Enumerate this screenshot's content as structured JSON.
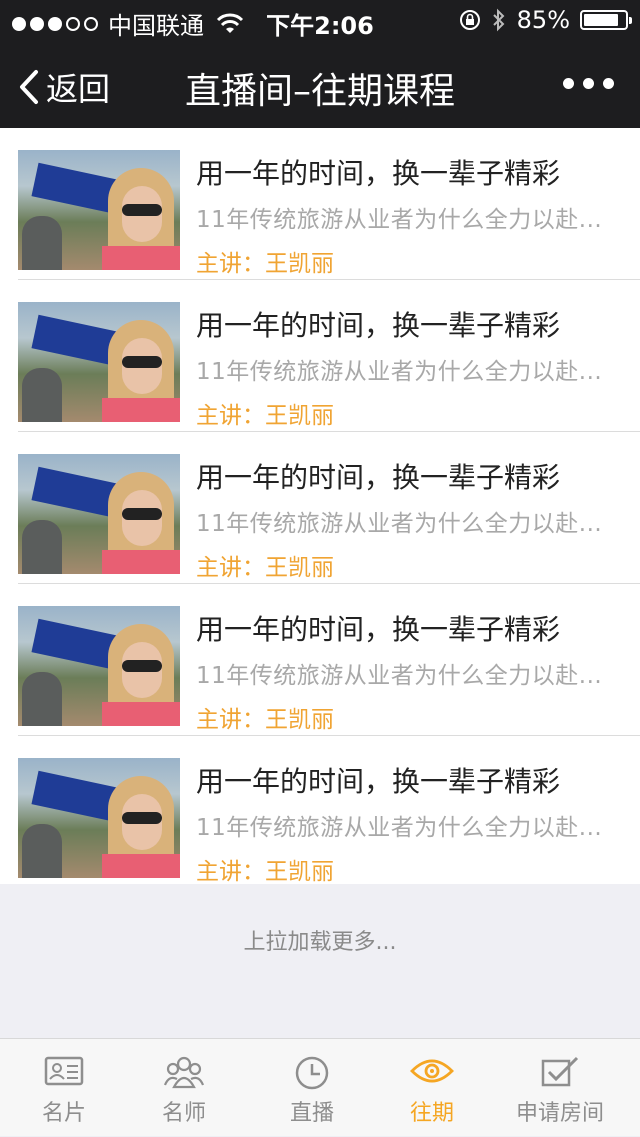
{
  "status_bar": {
    "carrier": "中国联通",
    "time": "下午2:06",
    "battery": "85%",
    "battery_level": 0.85,
    "icons": [
      "signal-dots-icon",
      "wifi-icon",
      "rotation-lock-icon",
      "bluetooth-icon",
      "battery-icon"
    ]
  },
  "nav": {
    "back_label": "返回",
    "title": "直播间–往期课程"
  },
  "courses": [
    {
      "title": "用一年的时间，换一辈子精彩",
      "desc": "11年传统旅游从业者为什么全力以赴...",
      "speaker": "主讲：王凯丽"
    },
    {
      "title": "用一年的时间，换一辈子精彩",
      "desc": "11年传统旅游从业者为什么全力以赴...",
      "speaker": "主讲：王凯丽"
    },
    {
      "title": "用一年的时间，换一辈子精彩",
      "desc": "11年传统旅游从业者为什么全力以赴...",
      "speaker": "主讲：王凯丽"
    },
    {
      "title": "用一年的时间，换一辈子精彩",
      "desc": "11年传统旅游从业者为什么全力以赴...",
      "speaker": "主讲：王凯丽"
    },
    {
      "title": "用一年的时间，换一辈子精彩",
      "desc": "11年传统旅游从业者为什么全力以赴...",
      "speaker": "主讲：王凯丽"
    }
  ],
  "load_more": "上拉加载更多...",
  "tabs": [
    {
      "label": "名片",
      "icon": "id-card-icon"
    },
    {
      "label": "名师",
      "icon": "group-icon"
    },
    {
      "label": "直播",
      "icon": "clock-icon"
    },
    {
      "label": "往期",
      "icon": "eye-icon",
      "active": true
    },
    {
      "label": "申请房间",
      "icon": "checkbox-icon"
    }
  ],
  "colors": {
    "nav_bg": "#1d1d1f",
    "accent": "#f5a623",
    "speaker_text": "#f0a433"
  }
}
